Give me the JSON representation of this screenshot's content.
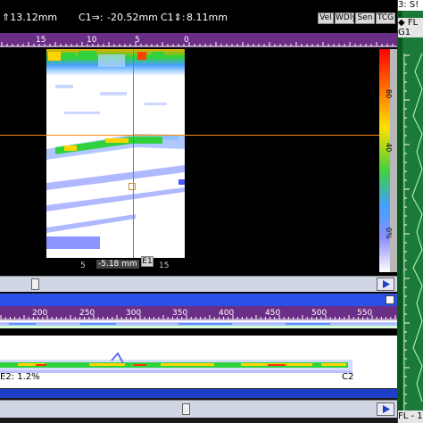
{
  "status": {
    "s_left": "⇑13.12mm",
    "c1_arrow": "C1⇒:",
    "c1_value": "-20.52mm",
    "c1_s": "C1⇕:",
    "c1_s_value": "8.11mm"
  },
  "toolbar_buttons": [
    "Vel",
    "WDly",
    "Sen",
    "TCG"
  ],
  "top_ruler": {
    "ticks": [
      "15",
      "10",
      "5",
      "0"
    ]
  },
  "cscan": {
    "cursor_label": "E1",
    "bottom_left_tick": "5",
    "bottom_value": "-5.18 mm",
    "bottom_right_tick": "15"
  },
  "colorbar": {
    "labels": [
      "80",
      "40",
      "0%"
    ]
  },
  "bottom_ruler": {
    "ticks": [
      "200",
      "250",
      "300",
      "350",
      "400",
      "450",
      "500",
      "550"
    ]
  },
  "bscan": {
    "left_label": "E2: 1.2%",
    "right_label": "C2"
  },
  "side_panel": {
    "title": "3: S! -",
    "head_line1": "◆ FL",
    "head_line2": "G1",
    "foot": "FL - 1"
  },
  "colors": {
    "ruler_purple": "#6b2e86",
    "title_blue": "#2a50e8",
    "cursor_orange": "#ff8c00",
    "side_green": "#1b7a3a"
  }
}
